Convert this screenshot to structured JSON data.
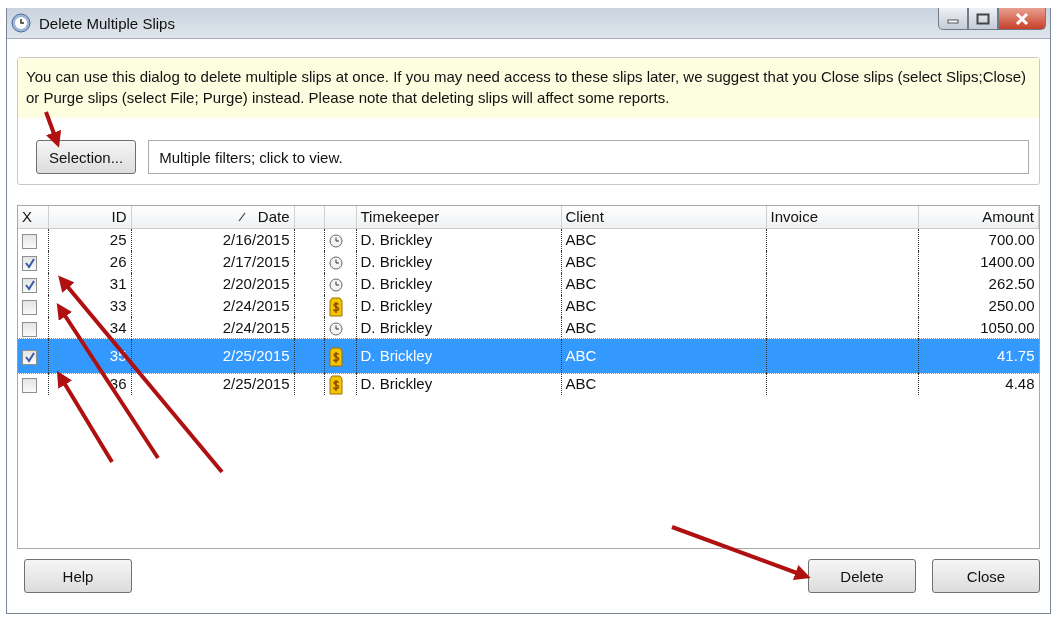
{
  "window": {
    "title": "Delete Multiple Slips"
  },
  "notice": "You can use this dialog to delete multiple slips at once. If you may need access to these slips later, we suggest that you Close slips (select Slips;Close) or Purge slips (select File; Purge) instead. Please note that deleting slips will affect some reports.",
  "selection_button": "Selection...",
  "filter_field": {
    "value": "Multiple filters; click to view."
  },
  "table": {
    "columns": [
      {
        "label": "X"
      },
      {
        "label": "ID"
      },
      {
        "label": "Date",
        "sorted": true
      },
      {},
      {},
      {
        "label": "Timekeeper"
      },
      {
        "label": "Client"
      },
      {
        "label": "Invoice"
      },
      {
        "label": "Amount"
      }
    ],
    "rows": [
      {
        "checked": false,
        "selected": false,
        "id": "25",
        "date": "2/16/2015",
        "kind": "clock",
        "timekeeper": "D. Brickley",
        "client": "ABC",
        "amount": "700.00"
      },
      {
        "checked": true,
        "selected": false,
        "id": "26",
        "date": "2/17/2015",
        "kind": "clock",
        "timekeeper": "D. Brickley",
        "client": "ABC",
        "amount": "1400.00"
      },
      {
        "checked": true,
        "selected": false,
        "id": "31",
        "date": "2/20/2015",
        "kind": "clock",
        "timekeeper": "D. Brickley",
        "client": "ABC",
        "amount": "262.50"
      },
      {
        "checked": false,
        "selected": false,
        "id": "33",
        "date": "2/24/2015",
        "kind": "dollar",
        "timekeeper": "D. Brickley",
        "client": "ABC",
        "amount": "250.00"
      },
      {
        "checked": false,
        "selected": false,
        "id": "34",
        "date": "2/24/2015",
        "kind": "clock",
        "timekeeper": "D. Brickley",
        "client": "ABC",
        "amount": "1050.00"
      },
      {
        "checked": true,
        "selected": true,
        "id": "35",
        "date": "2/25/2015",
        "kind": "dollar",
        "timekeeper": "D. Brickley",
        "client": "ABC",
        "amount": "41.75"
      },
      {
        "checked": false,
        "selected": false,
        "id": "36",
        "date": "2/25/2015",
        "kind": "dollar",
        "timekeeper": "D. Brickley",
        "client": "ABC",
        "amount": "4.48"
      }
    ]
  },
  "buttons": [
    {
      "label": "Help",
      "kind": "left"
    },
    {
      "label": "Delete",
      "kind": "right"
    },
    {
      "label": "Close",
      "kind": "right"
    }
  ]
}
